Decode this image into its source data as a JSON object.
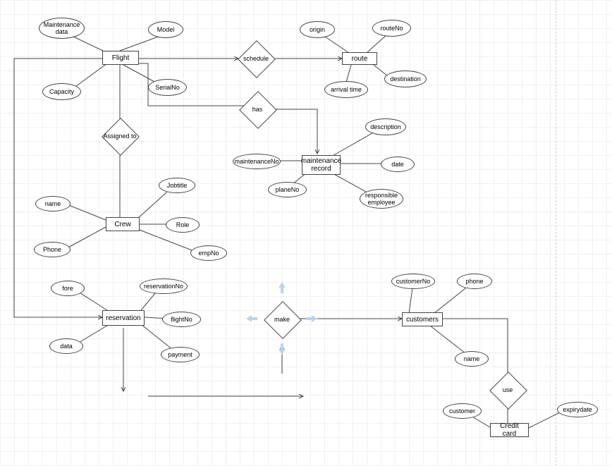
{
  "entities": {
    "flight": "Flight",
    "route": "route",
    "maintenance_record": "maintenance record",
    "crew": "Crew",
    "reservation": "reservation",
    "customers": "customers",
    "credit_card": "Credit card"
  },
  "relationships": {
    "schedule": "schedule",
    "has": "has",
    "assigned_to": "Assigned to",
    "make": "make",
    "use": "use"
  },
  "attributes": {
    "maintenance_data": "Maintenance data",
    "model": "Model",
    "capacity": "Capacity",
    "serialno": "SerialNo",
    "origin": "origin",
    "routeno": "routeNo",
    "arrival_time": "arrival time",
    "destination": "destination",
    "maintenanceno": "maintenanceNo",
    "planeno": "planeNo",
    "description": "description",
    "date": "date",
    "responsible_employee": "responsible employee",
    "name_crew": "name",
    "phone_crew": "Phone",
    "jobtitle": "Jobtitle",
    "role": "Role",
    "empno": "empNo",
    "fore": "fore",
    "data": "data",
    "reservationno": "reservationNo",
    "flightno": "flightNo",
    "payment": "payment",
    "customerno": "customerNo",
    "phone_cust": "phone",
    "name_cust": "name",
    "customer_cc": "customer",
    "expirydate": "expirydate"
  }
}
